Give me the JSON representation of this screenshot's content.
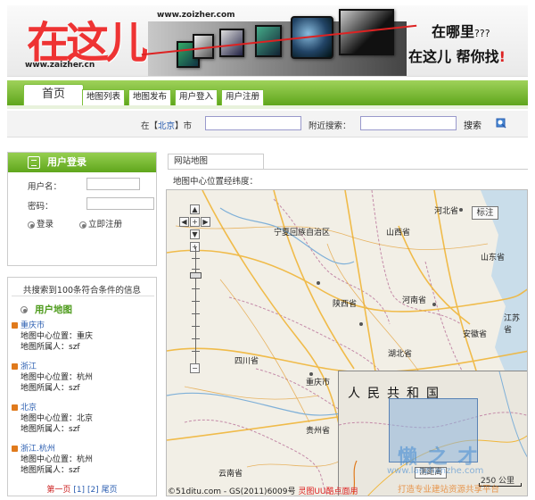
{
  "banner": {
    "logo_text": "在这儿",
    "logo_url": "www.zaizher.cn",
    "site_url": "www.zoizher.com",
    "tagline_1": "在哪里",
    "tagline_1_q": "???",
    "tagline_2": "在这儿 帮你找",
    "tagline_2_ex": "!"
  },
  "nav": {
    "home": "首页",
    "tabs": [
      "地图列表",
      "地图发布",
      "用户登入",
      "用户注册"
    ]
  },
  "search": {
    "loc_prefix": "在【",
    "city": "北京",
    "loc_suffix": "】市",
    "near_label": "附近搜索：",
    "search_button": "搜索"
  },
  "login": {
    "title": "用户登录",
    "username_label": "用户名：",
    "password_label": "密码：",
    "login_option": "登录",
    "register_option": "立即注册"
  },
  "results": {
    "summary": "共搜索到100条符合条件的信息",
    "heading": "用户地图",
    "items": [
      {
        "title": "重庆市",
        "center": "地图中心位置：重庆",
        "owner": "地图所属人：szf"
      },
      {
        "title": "浙江",
        "center": "地图中心位置：杭州",
        "owner": "地图所属人：szf"
      },
      {
        "title": "北京",
        "center": "地图中心位置：北京",
        "owner": "地图所属人：szf"
      },
      {
        "title": "浙江.杭州",
        "center": "地图中心位置：杭州",
        "owner": "地图所属人：szf"
      }
    ],
    "pager_first": "第一页",
    "pager_p1": "[1]",
    "pager_p2": "[2]",
    "pager_last": "尾页"
  },
  "map": {
    "tab": "网站地图",
    "coord_label": "地图中心位置经纬度：",
    "label_button": "标注",
    "provinces": [
      "河北省",
      "宁夏回族自治区",
      "山西省",
      "山东省",
      "陕西省",
      "河南省",
      "江苏省",
      "安徽省",
      "四川省",
      "湖北省",
      "重庆市",
      "贵州省",
      "云南省"
    ],
    "overview_title": "人民共和国",
    "measure_button": "测距离",
    "scale": "250 公里",
    "credit": "©51ditu.com - GS(2011)6009号",
    "credit_red": "灵图UU酷点面用"
  },
  "watermark": {
    "main": "懒 之 才",
    "sub": "www.lanzhanzhe.com",
    "sub2": "打造专业建站资源共享平台"
  },
  "colors": {
    "brand_green": "#5fa61c",
    "link_blue": "#2a5db0",
    "accent_red": "#d22222",
    "bullet_orange": "#e07a1c"
  }
}
